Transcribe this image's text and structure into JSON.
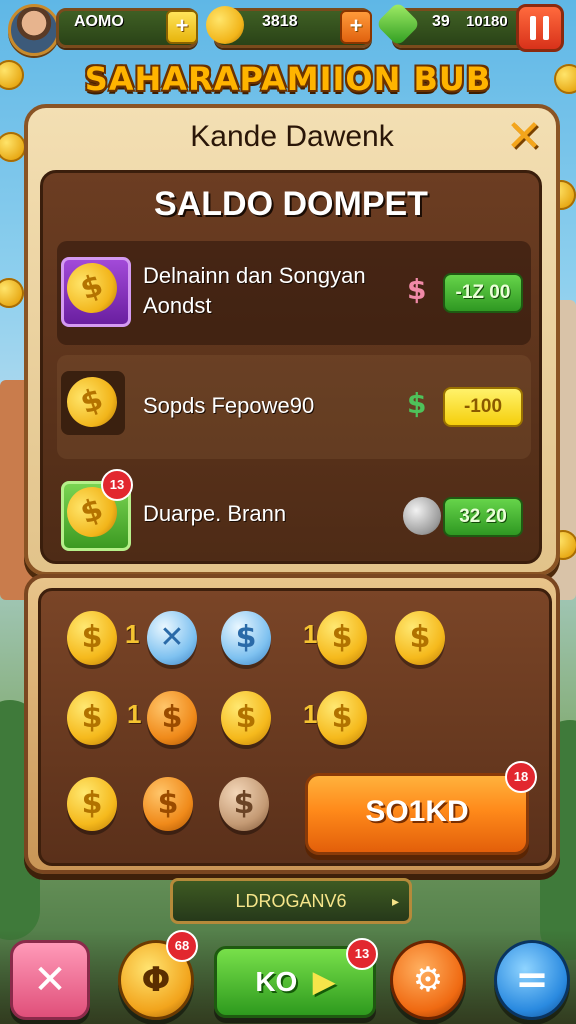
{
  "top_bar": {
    "resource_1_value": "AOMO",
    "resource_2_value": "3818",
    "resource_3_value": "39",
    "resource_3_secondary": "10180",
    "plus_label": "+"
  },
  "game_title": "SAHARAPAMIION BUB",
  "panel": {
    "title": "Kande Dawenk",
    "close_label": "✕",
    "section_title": "SALDO DOMPET",
    "rows": [
      {
        "label_line1": "Delnainn dan Songyan",
        "label_line2": "Aondst",
        "symbol": "$",
        "price": "-1Z 00",
        "price_style": "green"
      },
      {
        "label_line1": "Sopds Fepowe90",
        "label_line2": "",
        "symbol": "$",
        "price": "-100",
        "price_style": "yellow"
      },
      {
        "label_line1": "Duarpe. Brann",
        "label_line2": "",
        "symbol": "",
        "price": "32 20",
        "price_style": "green",
        "badge": "13"
      }
    ]
  },
  "coin_grid": {
    "separators": [
      "1",
      "1",
      "1",
      "1"
    ],
    "main_button_label": "SO1KD",
    "main_button_badge": "18"
  },
  "banner": {
    "label": "LDROGANV6",
    "chevron": "▸"
  },
  "bottom_bar": {
    "close_label": "✕",
    "coin_label": "Φ",
    "coin_badge": "68",
    "play_label": "KO",
    "play_badge": "13",
    "menu_label": "="
  },
  "colors": {
    "accent_orange": "#ff8a1a",
    "panel_brown": "#5a301a",
    "price_green": "#2f9822",
    "price_yellow": "#f5cf0c",
    "badge_red": "#e2272f"
  }
}
